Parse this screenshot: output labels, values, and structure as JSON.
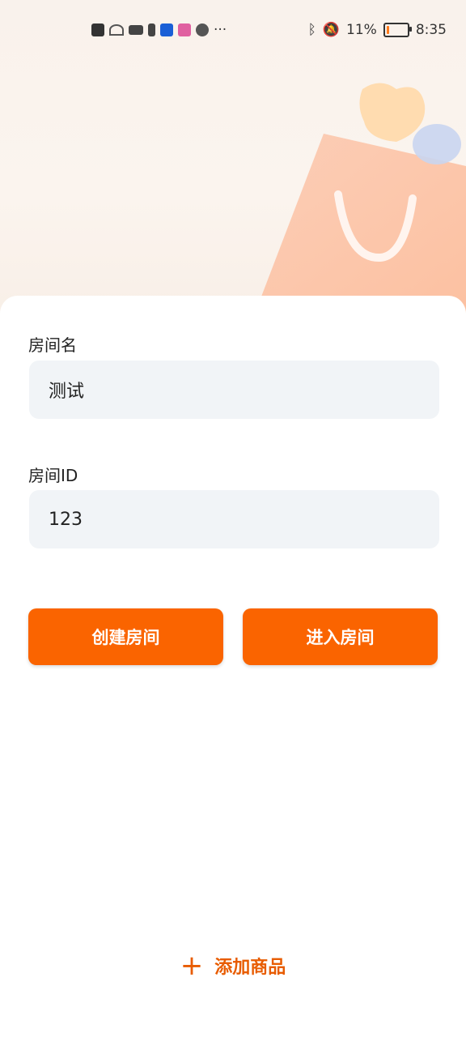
{
  "status_bar": {
    "battery_percent": "11%",
    "time": "8:35",
    "battery_level": 0.11,
    "more": "···",
    "icons": [
      "alert-icon",
      "wifi-icon",
      "camera-icon",
      "battery-small-icon",
      "bulb-icon",
      "app-icon",
      "globe-icon"
    ]
  },
  "form": {
    "room_name_label": "房间名",
    "room_name_value": "测试",
    "room_id_label": "房间ID",
    "room_id_value": "123"
  },
  "buttons": {
    "create": "创建房间",
    "enter": "进入房间"
  },
  "add_product": {
    "plus": "+",
    "label": "添加商品"
  },
  "colors": {
    "accent": "#fa6400",
    "input_bg": "#f1f4f7"
  }
}
